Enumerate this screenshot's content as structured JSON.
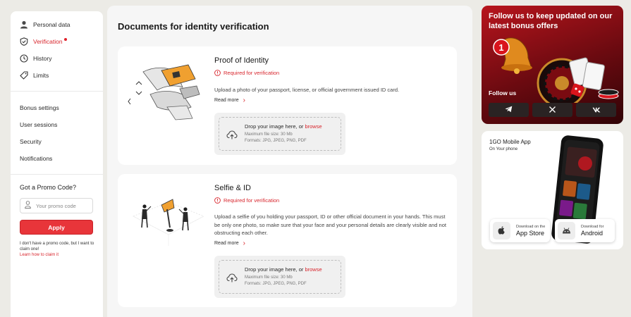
{
  "sidebar": {
    "items": [
      {
        "label": "Personal data",
        "icon": "user-icon"
      },
      {
        "label": "Verification",
        "icon": "shield-check-icon",
        "active": true
      },
      {
        "label": "History",
        "icon": "clock-icon"
      },
      {
        "label": "Limits",
        "icon": "tag-icon"
      }
    ],
    "settings": [
      {
        "label": "Bonus settings"
      },
      {
        "label": "User sessions"
      },
      {
        "label": "Security"
      },
      {
        "label": "Notifications"
      }
    ],
    "promo": {
      "title": "Got a Promo Code?",
      "placeholder": "Your promo code",
      "apply_label": "Apply",
      "note": "I don't have a promo code, but I want to claim one!",
      "link": "Learn how to claim it"
    }
  },
  "main": {
    "title": "Documents for identity verification",
    "cards": [
      {
        "title": "Proof of Identity",
        "required": "Required for verification",
        "description": "Upload a photo of your passport, license, or official government issued ID card.",
        "read_more": "Read more",
        "drop_text": "Drop your image here, or ",
        "browse": "browse",
        "max_size": "Maximum file size: 30 Mb",
        "formats": "Formats: JPG, JPEG, PNG, PDF"
      },
      {
        "title": "Selfie & ID",
        "required": "Required for verification",
        "description": "Upload a selfie of you holding your passport, ID or other official document in your hands. This must be only one photo, so make sure that your face and your personal details are clearly visible and not obstructing each other.",
        "read_more": "Read more",
        "drop_text": "Drop your image here, or ",
        "browse": "browse",
        "max_size": "Maximum file size: 30 Mb",
        "formats": "Formats: JPG, JPEG, PNG, PDF"
      }
    ]
  },
  "right": {
    "bonus": {
      "title": "Follow us to keep updated on our latest bonus offers",
      "badge": "1",
      "follow_label": "Follow us",
      "social": [
        "telegram-icon",
        "x-icon",
        "vk-icon"
      ]
    },
    "app": {
      "title": "1GO Mobile App",
      "subtitle": "On Your phone",
      "appstore_small": "Download on the",
      "appstore_big": "App Store",
      "android_small": "Download for",
      "android_big": "Android"
    }
  },
  "colors": {
    "accent": "#d8262d",
    "button": "#e8353a",
    "page_bg": "#ecebe6"
  }
}
